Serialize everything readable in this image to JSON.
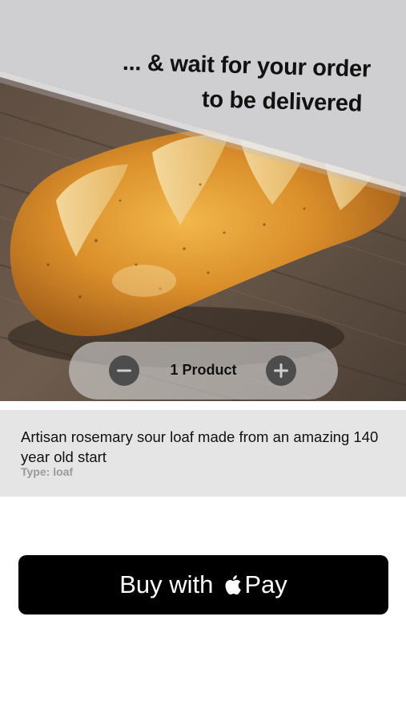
{
  "banner": {
    "line1": "... & wait for your order",
    "line2": "to be delivered"
  },
  "product": {
    "quantity_label": "1 Product",
    "description": "Artisan rosemary sour loaf made from an amazing 140 year old start",
    "type_line": "Type: loaf"
  },
  "checkout": {
    "buy_label": "Buy with",
    "pay_label": "Pay"
  },
  "colors": {
    "banner_bg": "#cfcfd1",
    "info_bg": "#e5e5e5",
    "button_bg": "#000000",
    "stepper_button": "#4d4d4d"
  },
  "icons": [
    "minus-icon",
    "plus-icon",
    "apple-logo-icon"
  ]
}
